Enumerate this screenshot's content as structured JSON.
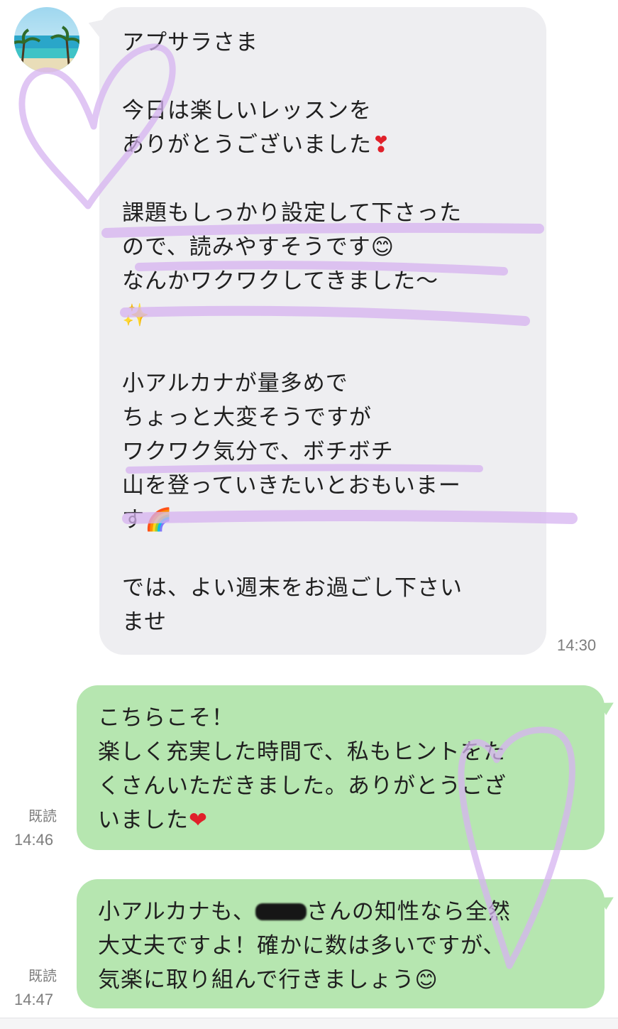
{
  "incoming": {
    "lines": [
      "アプサラさま",
      "",
      "今日は楽しいレッスンを",
      "ありがとうございました",
      "",
      "課題もしっかり設定して下さった",
      "ので、読みやすそうです",
      "なんかワクワクしてきました〜",
      "",
      "",
      "小アルカナが量多めで",
      "ちょっと大変そうですが",
      "ワクワク気分で、ボチボチ",
      "山を登っていきたいとおもいまー",
      "す",
      "",
      "では、よい週末をお過ごし下さい",
      "ませ"
    ],
    "emoji_heart": "❣",
    "emoji_smile": "😊",
    "emoji_sparkle": "✨",
    "emoji_rainbow": "🌈",
    "time": "14:30"
  },
  "outgoing": [
    {
      "lines": [
        "こちらこそ！",
        "楽しく充実した時間で、私もヒントをた",
        "くさんいただきました。ありがとうござ",
        "いました"
      ],
      "emoji": "❤",
      "read_label": "既読",
      "time": "14:46"
    },
    {
      "line1_before": "小アルカナも、",
      "line1_after": "さんの知性なら全然",
      "line2": "大丈夫ですよ！確かに数は多いですが、",
      "line3": "気楽に取り組んで行きましょう",
      "emoji": "😊",
      "read_label": "既読",
      "time": "14:47"
    }
  ],
  "colors": {
    "incoming_bubble": "#eeeef1",
    "outgoing_bubble": "#b6e6b0",
    "marker": "#d9b8f2"
  },
  "icons": {
    "avatar": "beach-avatar-icon"
  }
}
